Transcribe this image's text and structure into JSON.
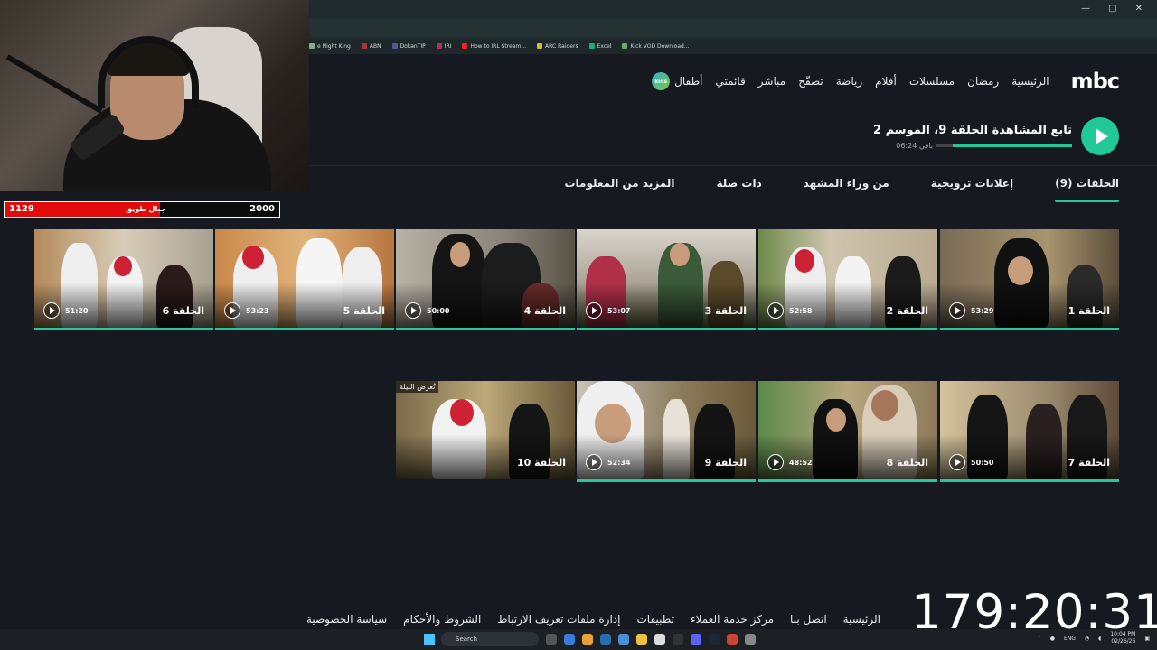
{
  "bookmarks": [
    "e Night King",
    "ABN",
    "DokanTIP",
    "IRI",
    "How to IRL Stream...",
    "ARC Raiders",
    "Excel",
    "Kick VOD Download..."
  ],
  "stream_bar": {
    "left_value": "1129",
    "center_label": "جبال طويق",
    "right_value": "2000",
    "fill_ratio": 0.565
  },
  "nav": {
    "logo": "mbc",
    "items": [
      "الرئيسية",
      "رمضان",
      "مسلسلات",
      "أفلام",
      "رياضة",
      "تصفّح",
      "مباشر",
      "قائمتي"
    ],
    "kids_badge": "kids",
    "kids_label": "أطفال"
  },
  "continue_watching": {
    "title": "تابع المشاهدة الحلقة 9، الموسم 2",
    "remaining": "06:24 باقي",
    "progress": 0.88
  },
  "tabs": [
    "الحلقات (9)",
    "إعلانات ترويجية",
    "من وراء المشهد",
    "ذات صلة",
    "المزيد من المعلومات"
  ],
  "episodes": [
    {
      "title": "الحلقة 1",
      "duration": "53:29"
    },
    {
      "title": "الحلقة 2",
      "duration": "52:58"
    },
    {
      "title": "الحلقة 3",
      "duration": "53:07"
    },
    {
      "title": "الحلقة 4",
      "duration": "50:00"
    },
    {
      "title": "الحلقة 5",
      "duration": "53:23"
    },
    {
      "title": "الحلقة 6",
      "duration": "51:20"
    },
    {
      "title": "الحلقة 7",
      "duration": "50:50"
    },
    {
      "title": "الحلقة 8",
      "duration": "48:52"
    },
    {
      "title": "الحلقة 9",
      "duration": "52:34"
    },
    {
      "title": "الحلقة 10",
      "duration": "",
      "tag": "تُعرض الليلة"
    }
  ],
  "footer": [
    "الرئيسية",
    "اتصل بنا",
    "مركز خدمة العملاء",
    "تطبيقات",
    "إدارة ملفات تعريف الارتباط",
    "الشروط والأحكام",
    "سياسة الخصوصية"
  ],
  "timer": "179:20:31",
  "taskbar": {
    "search_placeholder": "Search",
    "lang": "ENG",
    "time": "10:04 PM",
    "date": "02/26/26"
  },
  "colors": {
    "accent": "#20c997",
    "background": "#16191f",
    "stream_red": "#e30a0a"
  }
}
